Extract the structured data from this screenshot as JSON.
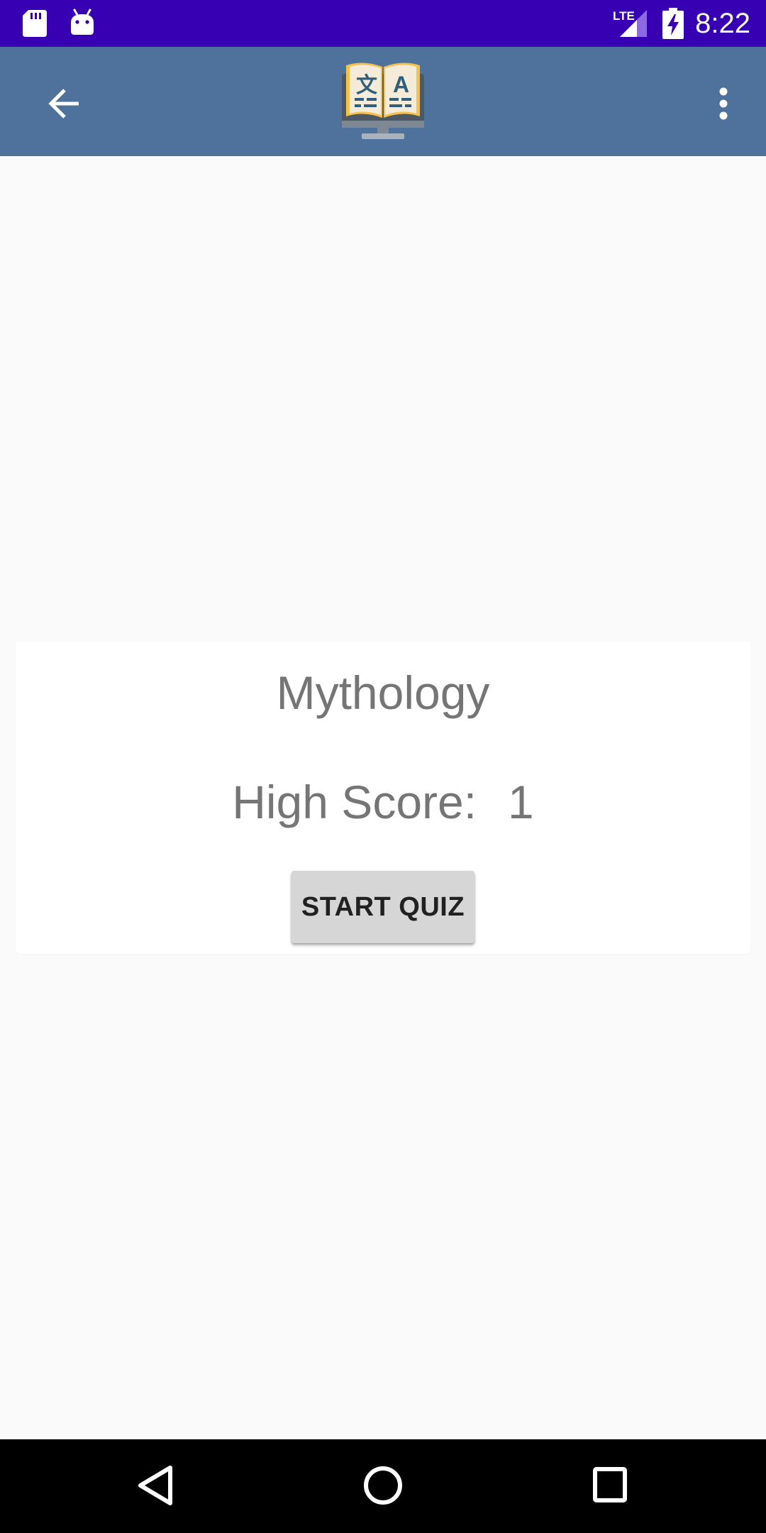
{
  "status_bar": {
    "time": "8:22",
    "network_label": "LTE",
    "icons": [
      "sd-card-icon",
      "android-icon",
      "lte-signal-icon",
      "battery-charging-icon"
    ],
    "color": "#3700b3"
  },
  "app_bar": {
    "color": "#4e729b",
    "icons": [
      "back-arrow-icon",
      "translation-book-logo",
      "more-vert-icon"
    ]
  },
  "card": {
    "title": "Mythology",
    "score_label": "High Score:",
    "score_value": "1",
    "start_button_label": "START QUIZ"
  },
  "nav_bar": {
    "icons": [
      "nav-back-icon",
      "nav-home-icon",
      "nav-recents-icon"
    ]
  }
}
